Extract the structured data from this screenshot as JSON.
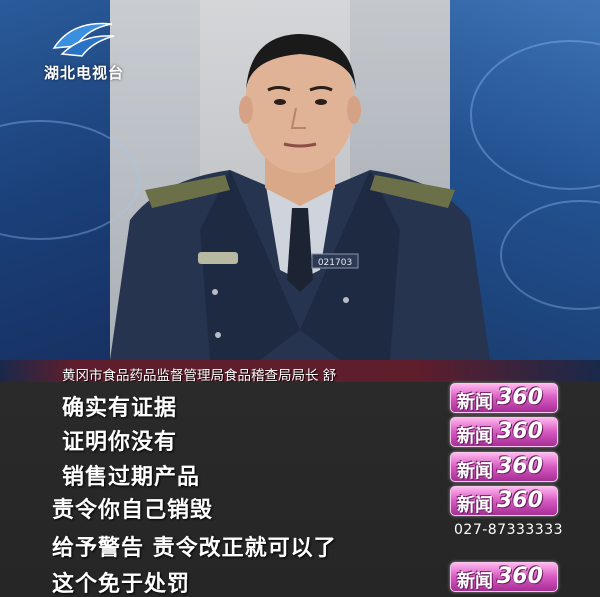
{
  "station": {
    "logo_text": "湖北电视台",
    "logo_color": "#3a8fe0"
  },
  "lower_third": {
    "caption": "黄冈市食品药品监督管理局食品稽查局局长   舒"
  },
  "subtitles": [
    "确实有证据",
    "证明你没有",
    "销售过期产品",
    "责令你自己销毁",
    "给予警告  责令改正就可以了",
    "这个免于处罚"
  ],
  "program_badge": {
    "cn": "新闻",
    "num": "360",
    "color": "#d659c0"
  },
  "hotline": "027-87333333",
  "uniform": {
    "badge_number": "021703",
    "color": "#26344f"
  }
}
